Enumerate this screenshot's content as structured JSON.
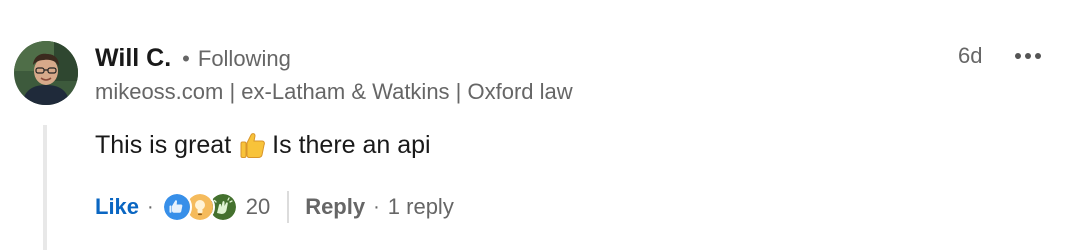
{
  "comment": {
    "author": {
      "name": "Will C.",
      "relation": "Following",
      "headline": "mikeoss.com | ex-Latham & Watkins | Oxford law",
      "avatar_icon": "profile-photo"
    },
    "timestamp": "6d",
    "more_icon": "ellipsis-icon",
    "body": {
      "text_before": "This is great",
      "emoji": "thumbs-up",
      "text_after": "Is there an api"
    },
    "actions": {
      "like_label": "Like",
      "reactions": [
        "like",
        "insightful",
        "celebrate"
      ],
      "reaction_count": "20",
      "reply_label": "Reply",
      "reply_count": "1 reply"
    },
    "colors": {
      "link_blue": "#0a66c2",
      "secondary_text": "#666666",
      "primary_text": "#191919"
    }
  }
}
